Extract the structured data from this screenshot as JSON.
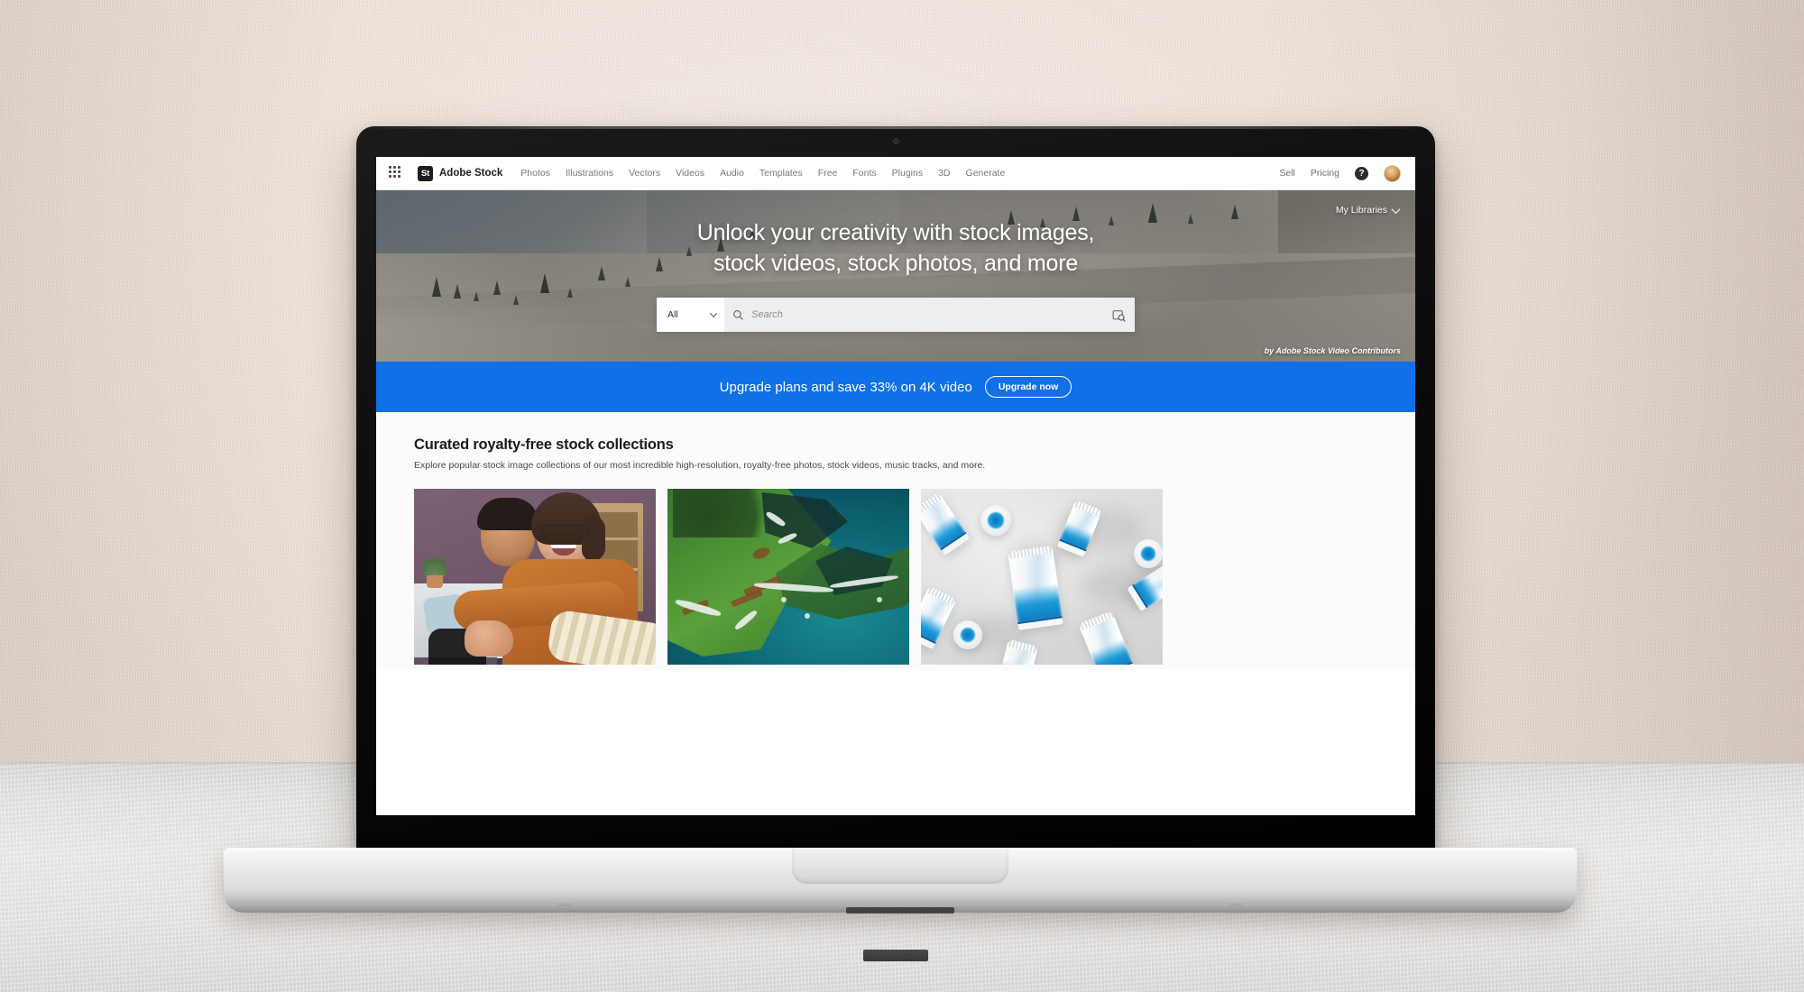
{
  "browser": {
    "site_name": "Adobe Stock"
  },
  "topnav": {
    "app_switcher_icon": "grid-apps-icon",
    "brand_mark": "St",
    "brand_name": "Adobe Stock",
    "links": [
      {
        "label": "Photos"
      },
      {
        "label": "Illustrations"
      },
      {
        "label": "Vectors"
      },
      {
        "label": "Videos"
      },
      {
        "label": "Audio"
      },
      {
        "label": "Templates"
      },
      {
        "label": "Free"
      },
      {
        "label": "Fonts"
      },
      {
        "label": "Plugins"
      },
      {
        "label": "3D"
      },
      {
        "label": "Generate"
      }
    ],
    "right_links": [
      {
        "label": "Sell"
      },
      {
        "label": "Pricing"
      }
    ],
    "help_icon": "help-question-icon",
    "help_glyph": "?",
    "avatar": "user-avatar"
  },
  "hero": {
    "my_libraries_label": "My Libraries",
    "my_libraries_icon": "chevron-down-icon",
    "title_line1": "Unlock your creativity with stock images,",
    "title_line2": "stock videos, stock photos, and more",
    "credit": "by Adobe Stock Video Contributors",
    "search": {
      "category_value": "All",
      "category_icon": "chevron-down-icon",
      "search_icon": "search-magnifier-icon",
      "placeholder": "Search",
      "value": "",
      "visual_search_icon": "visual-search-camera-icon"
    }
  },
  "promo": {
    "text": "Upgrade plans and save 33% on 4K video",
    "button_label": "Upgrade now",
    "background_color": "#0f70e8"
  },
  "curated": {
    "heading": "Curated royalty-free stock collections",
    "subheading": "Explore popular stock image collections of our most incredible high-resolution, royalty-free photos, stock videos, music tracks, and more.",
    "cards": [
      {
        "name": "card-couple-embracing",
        "alt": "Smiling couple embracing in a living room"
      },
      {
        "name": "card-aerial-coastline",
        "alt": "Aerial view of green coastline and teal ocean"
      },
      {
        "name": "card-cosmetic-tubes",
        "alt": "White and blue cosmetic tubes and jars on gray surface"
      }
    ]
  },
  "scene": {
    "wall_color": "#eee2d9",
    "desk_color": "#e6e4e2",
    "laptop_bezel_color": "#000000",
    "laptop_base_color": "#dcdcdc"
  }
}
